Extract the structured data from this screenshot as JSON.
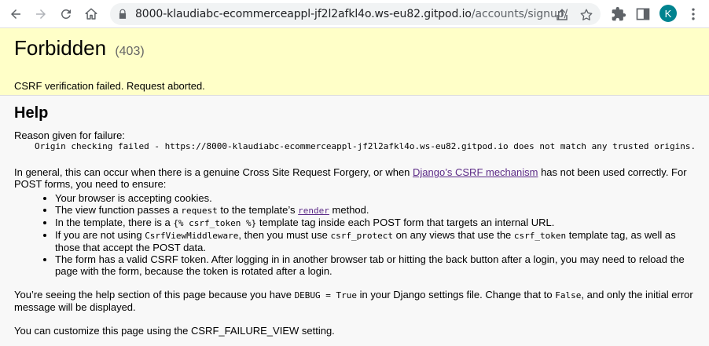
{
  "browser": {
    "url_host": "8000-klaudiabc-ecommerceappl-jf2l2afkl4o.ws-eu82.gitpod.io",
    "url_path": "/accounts/signup/",
    "avatar_letter": "K",
    "icons": [
      "back-icon",
      "forward-icon",
      "reload-icon",
      "home-icon",
      "lock-icon",
      "share-icon",
      "star-icon",
      "extensions-icon",
      "sidepanel-icon",
      "menu-icon"
    ],
    "avatar_color": "#00838f"
  },
  "summary": {
    "title": "Forbidden",
    "code": "(403)",
    "message": "CSRF verification failed. Request aborted.",
    "bg_color": "#ffffc8"
  },
  "help": {
    "heading": "Help",
    "reason_label": "Reason given for failure:",
    "reason_text": "Origin checking failed - https://8000-klaudiabc-ecommerceappl-jf2l2afkl4o.ws-eu82.gitpod.io does not match any trusted origins.",
    "general_before_link": "In general, this can occur when there is a genuine Cross Site Request Forgery, or when ",
    "general_link": "Django’s CSRF mechanism",
    "general_after_link": " has not been used correctly. For POST forms, you need to ensure:",
    "bullets": {
      "b1": "Your browser is accepting cookies.",
      "b2_before": "The view function passes a ",
      "b2_code": "request",
      "b2_mid": " to the template’s ",
      "b2_link": "render",
      "b2_after": " method.",
      "b3_before": "In the template, there is a ",
      "b3_code": "{% csrf_token %}",
      "b3_after": " template tag inside each POST form that targets an internal URL.",
      "b4_before": "If you are not using ",
      "b4_code1": "CsrfViewMiddleware",
      "b4_mid1": ", then you must use ",
      "b4_code2": "csrf_protect",
      "b4_mid2": " on any views that use the ",
      "b4_code3": "csrf_token",
      "b4_after": " template tag, as well as those that accept the POST data.",
      "b5": "The form has a valid CSRF token. After logging in in another browser tab or hitting the back button after a login, you may need to reload the page with the form, because the token is rotated after a login."
    },
    "debug_before": "You’re seeing the help section of this page because you have ",
    "debug_code": "DEBUG = True",
    "debug_mid": " in your Django settings file. Change that to ",
    "debug_code2": "False",
    "debug_after": ", and only the initial error message will be displayed.",
    "customize": "You can customize this page using the CSRF_FAILURE_VIEW setting.",
    "link_color": "#5b2a86"
  }
}
